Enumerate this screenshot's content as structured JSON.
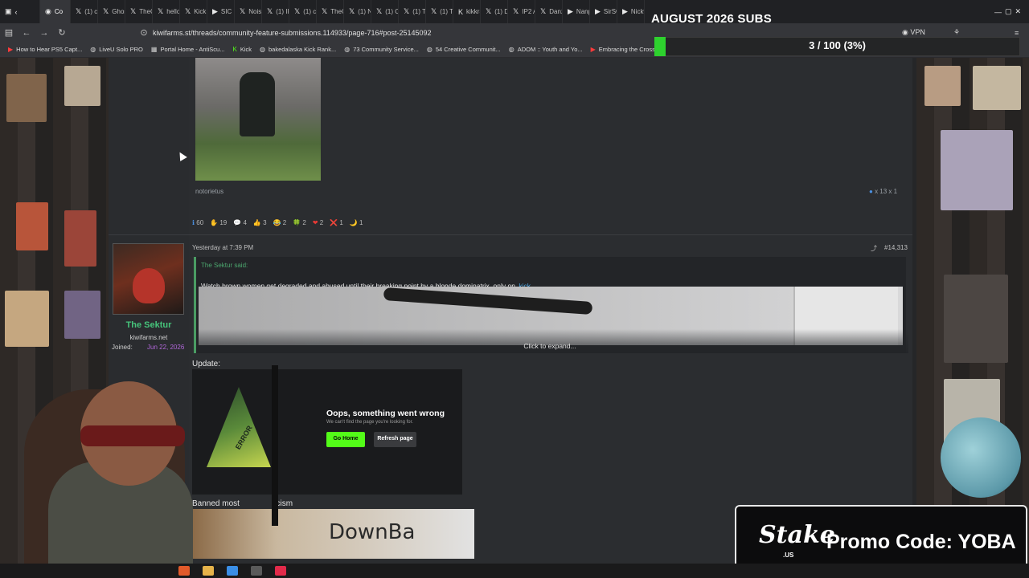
{
  "browser": {
    "tabs": [
      {
        "icon": "firefox-icon",
        "label": "Co"
      },
      {
        "icon": "x-icon",
        "label": "(1) cu"
      },
      {
        "icon": "x-icon",
        "label": "Ghost"
      },
      {
        "icon": "x-icon",
        "label": "TheCl"
      },
      {
        "icon": "x-icon",
        "label": "hello"
      },
      {
        "icon": "x-icon",
        "label": "Kick h"
      },
      {
        "icon": "play-icon",
        "label": "SIC b"
      },
      {
        "icon": "x-icon",
        "label": "Noise"
      },
      {
        "icon": "x-icon",
        "label": "(1) IP2"
      },
      {
        "icon": "x-icon",
        "label": "(1) cu"
      },
      {
        "icon": "x-icon",
        "label": "TheCl"
      },
      {
        "icon": "x-icon",
        "label": "(1) N"
      },
      {
        "icon": "x-icon",
        "label": "(1) Cli"
      },
      {
        "icon": "x-icon",
        "label": "(1) Tr"
      },
      {
        "icon": "x-icon",
        "label": "(1) Tr"
      },
      {
        "icon": "kick-icon",
        "label": "kikkra"
      },
      {
        "icon": "x-icon",
        "label": "(1) Di"
      },
      {
        "icon": "x-icon",
        "label": "IP2 A"
      },
      {
        "icon": "x-icon",
        "label": "Danz"
      },
      {
        "icon": "youtube-icon",
        "label": "Nanp"
      },
      {
        "icon": "youtube-icon",
        "label": "SirSw"
      },
      {
        "icon": "youtube-icon",
        "label": "Nickw"
      }
    ],
    "url": "kiwifarms.st/threads/community-feature-submissions.114933/page-716#post-25145092",
    "vpn_label": "VPN",
    "bookmarks": [
      {
        "icon": "youtube-icon",
        "label": "How to Hear PS5 Capt..."
      },
      {
        "icon": "globe-icon",
        "label": "LiveU Solo PRO"
      },
      {
        "icon": "folder-icon",
        "label": "Portal Home - AntiScu..."
      },
      {
        "icon": "kick-icon",
        "label": "Kick"
      },
      {
        "icon": "globe-icon",
        "label": "bakedalaska Kick Rank..."
      },
      {
        "icon": "globe-icon",
        "label": "73 Community Service..."
      },
      {
        "icon": "globe-icon",
        "label": "54 Creative Communit..."
      },
      {
        "icon": "globe-icon",
        "label": "ADOM :: Youth and Yo..."
      },
      {
        "icon": "youtube-icon",
        "label": "Embracing the Cross a..."
      }
    ]
  },
  "post1": {
    "caption": "notorietus",
    "right_meta": "x 13   x 1",
    "reactions": [
      "60",
      "19",
      "4",
      "3",
      "2",
      "2",
      "2",
      "1",
      "1"
    ]
  },
  "post2": {
    "time": "Yesterday at 7:39 PM",
    "number": "#14,313",
    "user": {
      "name": "The Sektur",
      "site": "kiwifarms.net",
      "joined_label": "Joined:",
      "joined_date": "Jun 22, 2026"
    },
    "quote_author": "The Sektur said:",
    "quote_text": "Watch brown women get degraded and abused until their breaking point by a blonde dominatrix, only on",
    "quote_link": "kick",
    "expand": "Click to expand...",
    "update_label": "Update:",
    "error_title": "Oops, something went wrong",
    "error_sub": "We can't find the page you're looking for.",
    "go_home": "Go Home",
    "refresh": "Refresh page",
    "image_text": "ERROR",
    "banned_text": "Banned most",
    "banned_text_2": "acism",
    "sign_text": "DownBa"
  },
  "overlay": {
    "sub_goal_title": "AUGUST 2026 SUBS",
    "sub_goal_text": "3 / 100 (3%)",
    "sub_goal_fraction": 0.03,
    "promo_logo": "Stake",
    "promo_logo_sub": ".US",
    "promo_code": "Promo Code: YOBA"
  }
}
